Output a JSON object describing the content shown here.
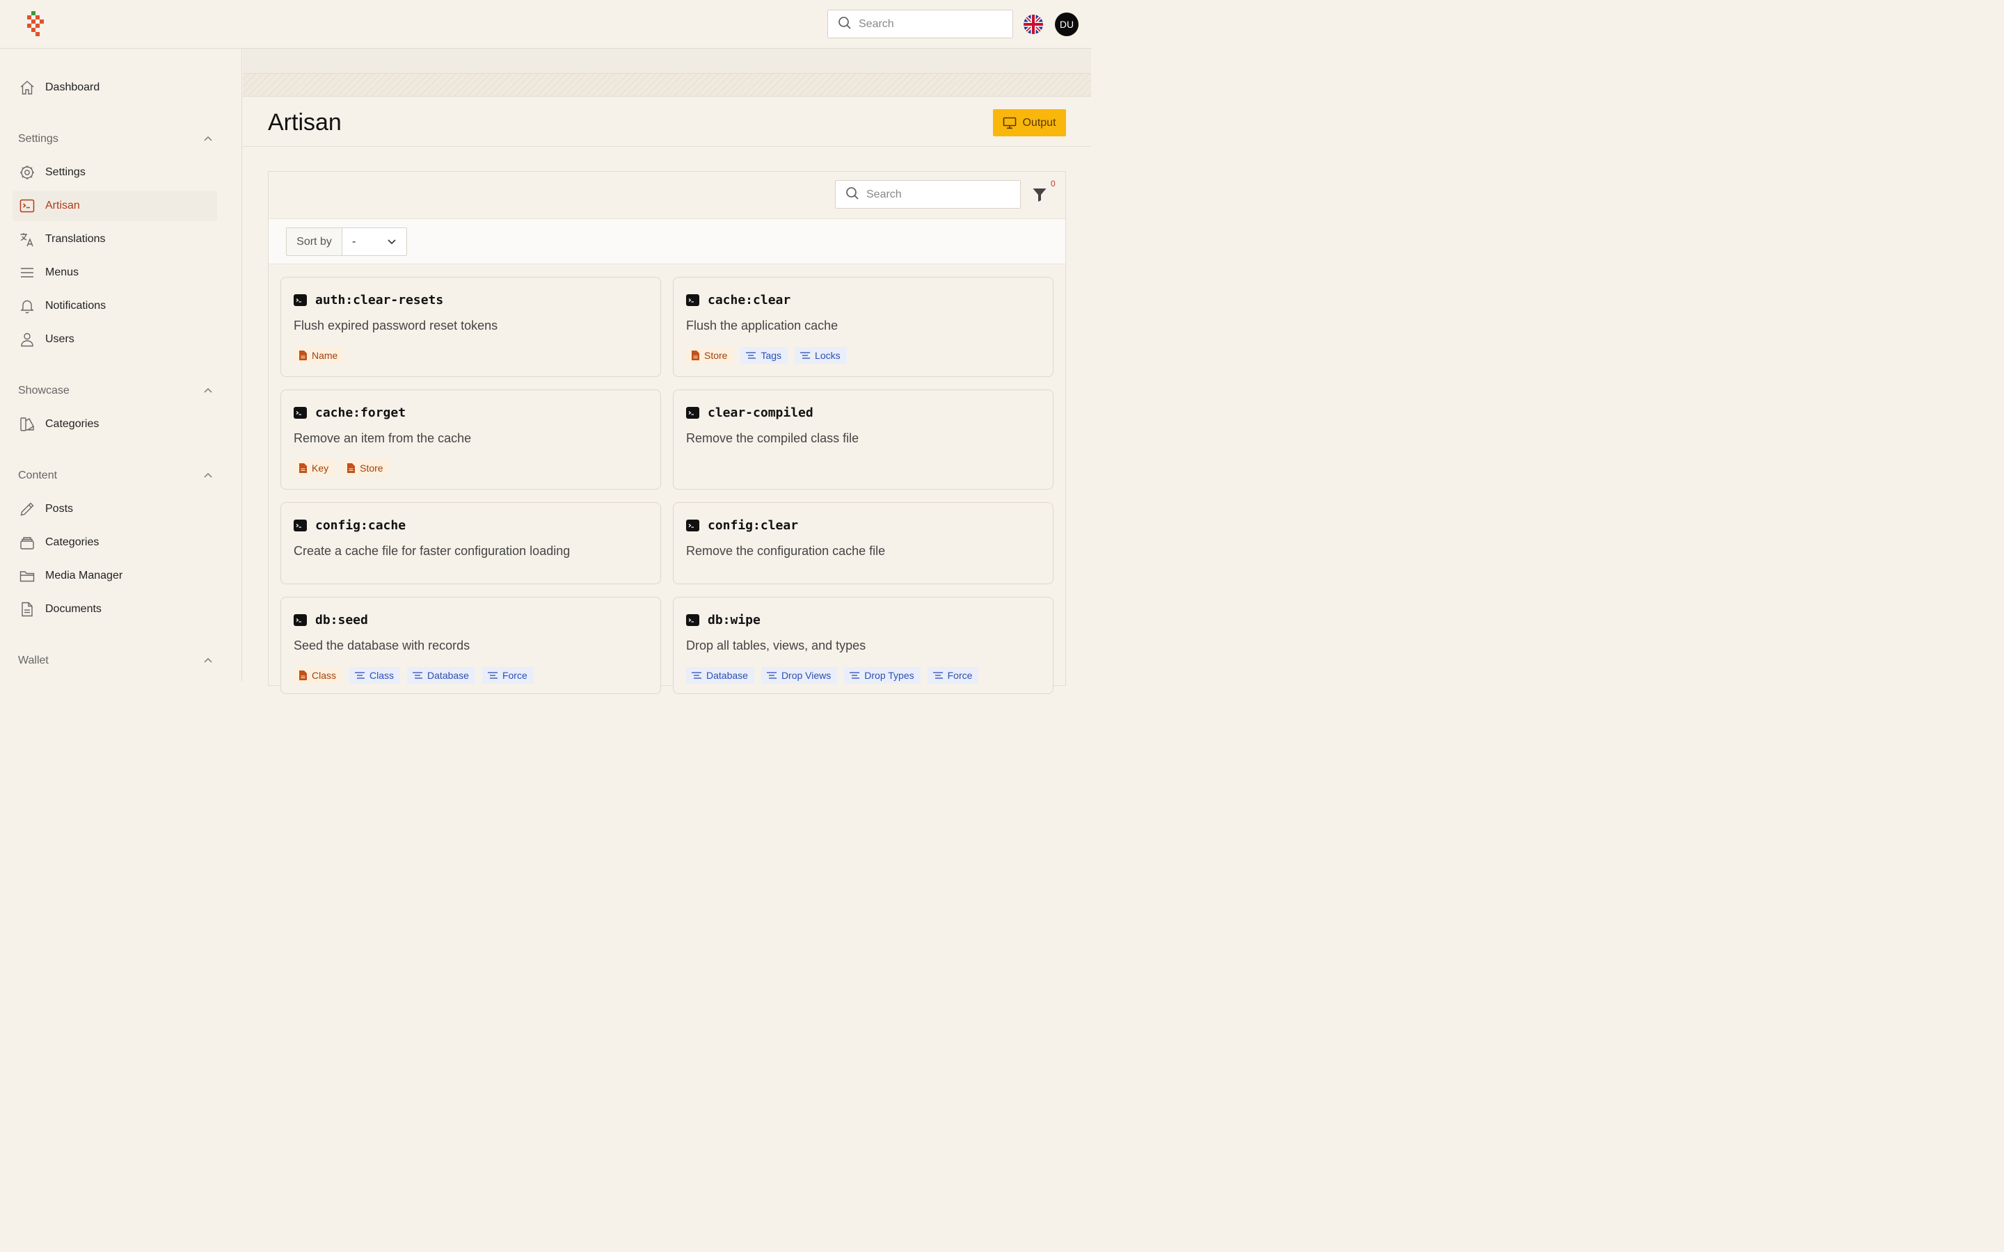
{
  "colors": {
    "accent": "#b23a1b",
    "output_button": "#f9b70c",
    "file_tag": "#a0410f",
    "option_tag": "#2d4fb0"
  },
  "topbar": {
    "search_placeholder": "Search",
    "language_icon": "uk-flag-icon",
    "avatar_initials": "DU"
  },
  "sidebar": {
    "items_main": [
      {
        "label": "Dashboard",
        "icon": "home-icon"
      }
    ],
    "sections": [
      {
        "title": "Settings",
        "items": [
          {
            "label": "Settings",
            "icon": "gear-icon"
          },
          {
            "label": "Artisan",
            "icon": "terminal-icon",
            "active": true
          },
          {
            "label": "Translations",
            "icon": "translate-icon"
          },
          {
            "label": "Menus",
            "icon": "menu-icon"
          },
          {
            "label": "Notifications",
            "icon": "bell-icon"
          },
          {
            "label": "Users",
            "icon": "user-icon"
          }
        ]
      },
      {
        "title": "Showcase",
        "items": [
          {
            "label": "Categories",
            "icon": "swatch-icon"
          }
        ]
      },
      {
        "title": "Content",
        "items": [
          {
            "label": "Posts",
            "icon": "pencil-icon"
          },
          {
            "label": "Categories",
            "icon": "stack-icon"
          },
          {
            "label": "Media Manager",
            "icon": "folder-icon"
          },
          {
            "label": "Documents",
            "icon": "document-icon"
          }
        ]
      },
      {
        "title": "Wallet",
        "items": []
      }
    ]
  },
  "page": {
    "title": "Artisan",
    "output_label": "Output"
  },
  "panel": {
    "search_placeholder": "Search",
    "filter_count": "0",
    "sort_label": "Sort by",
    "sort_value": "-"
  },
  "commands": [
    {
      "name": "auth:clear-resets",
      "description": "Flush expired password reset tokens",
      "tags": [
        {
          "label": "Name",
          "kind": "file"
        }
      ]
    },
    {
      "name": "cache:clear",
      "description": "Flush the application cache",
      "tags": [
        {
          "label": "Store",
          "kind": "file"
        },
        {
          "label": "Tags",
          "kind": "opt"
        },
        {
          "label": "Locks",
          "kind": "opt"
        }
      ]
    },
    {
      "name": "cache:forget",
      "description": "Remove an item from the cache",
      "tags": [
        {
          "label": "Key",
          "kind": "file"
        },
        {
          "label": "Store",
          "kind": "file"
        }
      ]
    },
    {
      "name": "clear-compiled",
      "description": "Remove the compiled class file",
      "tags": []
    },
    {
      "name": "config:cache",
      "description": "Create a cache file for faster configuration loading",
      "tags": []
    },
    {
      "name": "config:clear",
      "description": "Remove the configuration cache file",
      "tags": []
    },
    {
      "name": "db:seed",
      "description": "Seed the database with records",
      "tags": [
        {
          "label": "Class",
          "kind": "file"
        },
        {
          "label": "Class",
          "kind": "opt"
        },
        {
          "label": "Database",
          "kind": "opt"
        },
        {
          "label": "Force",
          "kind": "opt"
        }
      ]
    },
    {
      "name": "db:wipe",
      "description": "Drop all tables, views, and types",
      "tags": [
        {
          "label": "Database",
          "kind": "opt"
        },
        {
          "label": "Drop Views",
          "kind": "opt"
        },
        {
          "label": "Drop Types",
          "kind": "opt"
        },
        {
          "label": "Force",
          "kind": "opt"
        }
      ]
    }
  ]
}
